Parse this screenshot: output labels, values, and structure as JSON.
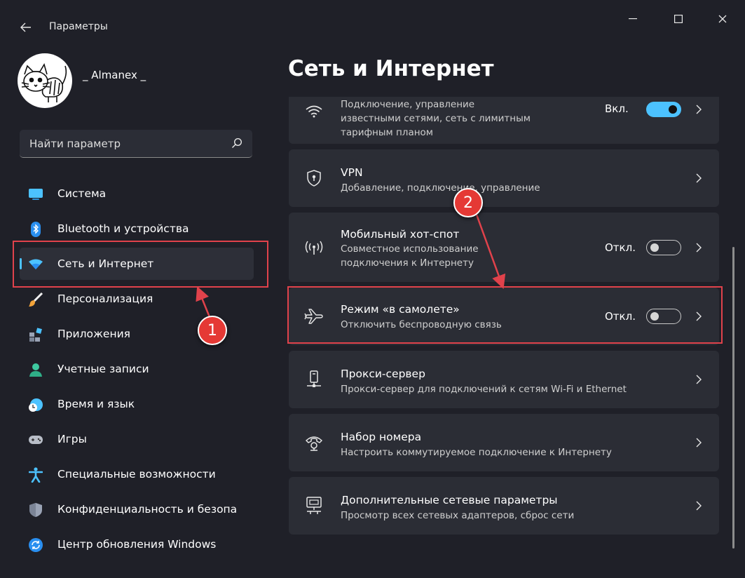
{
  "window": {
    "title": "Параметры"
  },
  "user": {
    "name": "_ Almanex _"
  },
  "search": {
    "placeholder": "Найти параметр"
  },
  "sidebar": {
    "items": [
      {
        "label": "Система",
        "icon": "display-icon"
      },
      {
        "label": "Bluetooth и устройства",
        "icon": "bluetooth-icon"
      },
      {
        "label": "Сеть и Интернет",
        "icon": "wifi-icon",
        "active": true
      },
      {
        "label": "Персонализация",
        "icon": "brush-icon"
      },
      {
        "label": "Приложения",
        "icon": "apps-icon"
      },
      {
        "label": "Учетные записи",
        "icon": "person-icon"
      },
      {
        "label": "Время и язык",
        "icon": "clock-globe-icon"
      },
      {
        "label": "Игры",
        "icon": "gamepad-icon"
      },
      {
        "label": "Специальные возможности",
        "icon": "accessibility-icon"
      },
      {
        "label": "Конфиденциальность и безопас",
        "icon": "shield-icon"
      },
      {
        "label": "Центр обновления Windows",
        "icon": "update-icon"
      }
    ]
  },
  "main": {
    "title": "Сеть и Интернет",
    "cards": [
      {
        "desc_line1": "Подключение, управление",
        "desc_line2": "известными сетями, сеть с лимитным",
        "desc_line3": "тарифным планом",
        "state": "Вкл.",
        "toggle_on": true,
        "icon": "wifi-icon"
      },
      {
        "title": "VPN",
        "desc": "Добавление, подключение, управление",
        "icon": "vpn-shield-icon"
      },
      {
        "title": "Мобильный хот-спот",
        "desc_line1": "Совместное использование",
        "desc_line2": "подключения к Интернету",
        "state": "Откл.",
        "toggle_on": false,
        "icon": "hotspot-icon"
      },
      {
        "title": "Режим «в самолете»",
        "desc": "Отключить беспроводную связь",
        "state": "Откл.",
        "toggle_on": false,
        "icon": "airplane-icon"
      },
      {
        "title": "Прокси-сервер",
        "desc": "Прокси-сервер для подключений к сетям Wi-Fi и Ethernet",
        "icon": "proxy-icon"
      },
      {
        "title": "Набор номера",
        "desc": "Настроить коммутируемое подключение к Интернету",
        "icon": "dialup-icon"
      },
      {
        "title": "Дополнительные сетевые параметры",
        "desc": "Просмотр всех сетевых адаптеров, сброс сети",
        "icon": "network-adapter-icon"
      }
    ]
  },
  "annotations": {
    "badge1": "1",
    "badge2": "2",
    "color": "#e0424b"
  },
  "colors": {
    "accent": "#4cc2ff",
    "background": "#1f2028",
    "card": "#2b2d35"
  }
}
